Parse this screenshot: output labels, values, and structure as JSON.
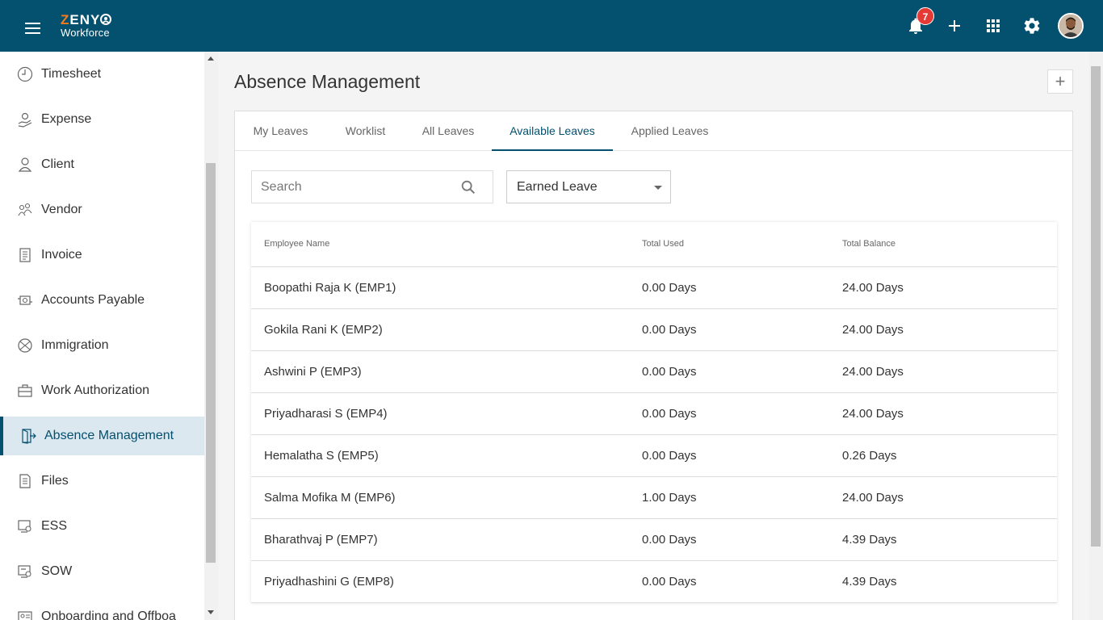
{
  "app": {
    "logo_top": "ZENY",
    "logo_bottom": "Workforce",
    "notification_count": "7"
  },
  "sidebar": {
    "items": [
      {
        "label": "Timesheet",
        "icon": "clock-icon"
      },
      {
        "label": "Expense",
        "icon": "hand-coin-icon"
      },
      {
        "label": "Client",
        "icon": "user-icon"
      },
      {
        "label": "Vendor",
        "icon": "users-icon"
      },
      {
        "label": "Invoice",
        "icon": "invoice-icon"
      },
      {
        "label": "Accounts Payable",
        "icon": "payable-icon"
      },
      {
        "label": "Immigration",
        "icon": "globe-icon"
      },
      {
        "label": "Work Authorization",
        "icon": "briefcase-icon"
      },
      {
        "label": "Absence Management",
        "icon": "exit-door-icon",
        "active": true
      },
      {
        "label": "Files",
        "icon": "file-icon"
      },
      {
        "label": "ESS",
        "icon": "ess-icon"
      },
      {
        "label": "SOW",
        "icon": "sow-icon"
      },
      {
        "label": "Onboarding and Offboa",
        "icon": "onboarding-icon"
      }
    ]
  },
  "page": {
    "title": "Absence Management",
    "add_label": "+"
  },
  "tabs": [
    {
      "label": "My Leaves"
    },
    {
      "label": "Worklist"
    },
    {
      "label": "All Leaves"
    },
    {
      "label": "Available Leaves",
      "active": true
    },
    {
      "label": "Applied Leaves"
    }
  ],
  "filters": {
    "search_placeholder": "Search",
    "leave_type": "Earned Leave"
  },
  "table": {
    "headers": [
      "Employee Name",
      "Total Used",
      "Total Balance"
    ],
    "rows": [
      [
        "Boopathi Raja K (EMP1)",
        "0.00 Days",
        "24.00 Days"
      ],
      [
        "Gokila Rani K (EMP2)",
        "0.00 Days",
        "24.00 Days"
      ],
      [
        "Ashwini P (EMP3)",
        "0.00 Days",
        "24.00 Days"
      ],
      [
        "Priyadharasi S (EMP4)",
        "0.00 Days",
        "24.00 Days"
      ],
      [
        "Hemalatha S (EMP5)",
        "0.00 Days",
        "0.26 Days"
      ],
      [
        "Salma Mofika M (EMP6)",
        "1.00 Days",
        "24.00 Days"
      ],
      [
        "Bharathvaj P (EMP7)",
        "0.00 Days",
        "4.39 Days"
      ],
      [
        "Priyadhashini G (EMP8)",
        "0.00 Days",
        "4.39 Days"
      ]
    ]
  },
  "colors": {
    "header_bg": "#03506f",
    "accent": "#03506f",
    "brand_orange": "#f47b20",
    "badge": "#e53935"
  }
}
